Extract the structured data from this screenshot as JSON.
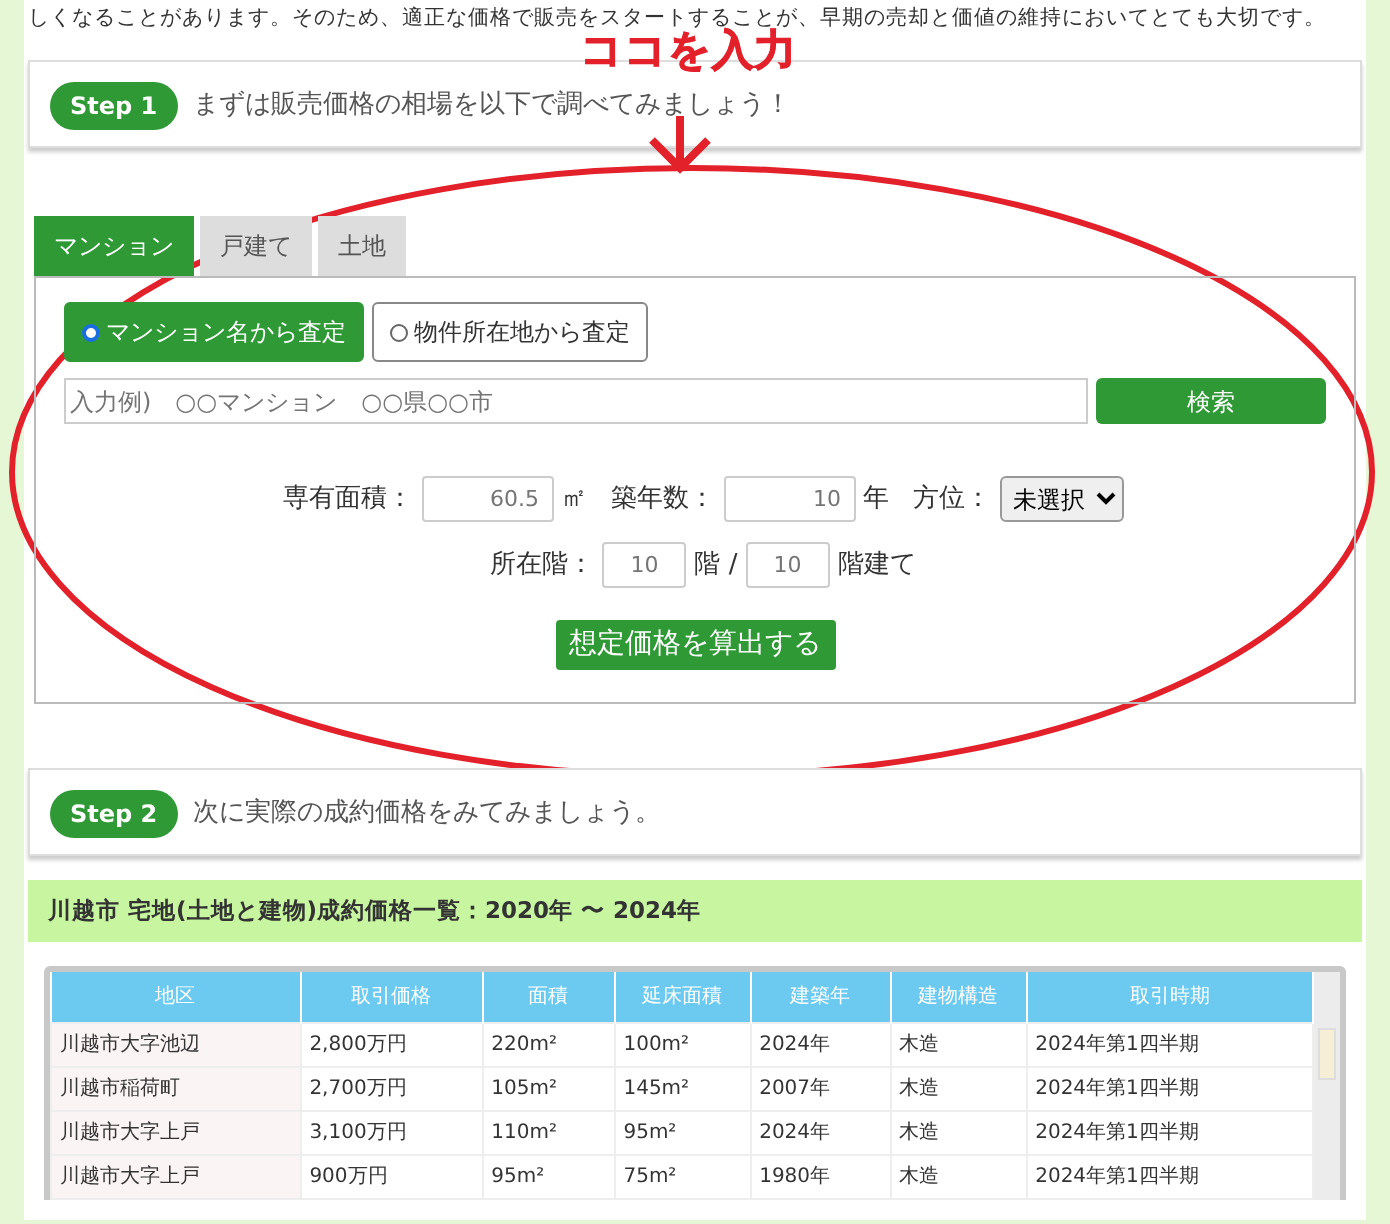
{
  "intro_text": "しくなることがあります。そのため、適正な価格で販売をスタートすることが、早期の売却と価値の維持においてとても大切です。",
  "annotation": {
    "label": "ココを入力"
  },
  "step1": {
    "badge": "Step 1",
    "text": "まずは販売価格の相場を以下で調べてみましょう！"
  },
  "tabs": [
    {
      "label": "マンション",
      "selected": true
    },
    {
      "label": "戸建て",
      "selected": false
    },
    {
      "label": "土地",
      "selected": false
    }
  ],
  "modes": [
    {
      "label": "マンション名から査定",
      "selected": true
    },
    {
      "label": "物件所在地から査定",
      "selected": false
    }
  ],
  "search": {
    "placeholder": "入力例)　○○マンション　○○県○○市",
    "button": "検索"
  },
  "fields_row1": [
    {
      "kind": "input",
      "label": "専有面積：",
      "placeholder": "60.5",
      "unit": "㎡"
    },
    {
      "kind": "input",
      "label": "築年数：",
      "placeholder": "10",
      "unit": "年"
    },
    {
      "kind": "select",
      "label": "方位：",
      "value": "未選択"
    }
  ],
  "fields_row2": [
    {
      "kind": "input",
      "label": "所在階：",
      "placeholder": "10",
      "unit": "階 /"
    },
    {
      "kind": "input",
      "placeholder": "10",
      "unit": "階建て"
    }
  ],
  "calc_button": "想定価格を算出する",
  "step2": {
    "badge": "Step 2",
    "text": "次に実際の成約価格をみてみましょう。"
  },
  "table_heading": "川越市 宅地(土地と建物)成約価格一覧：2020年 〜 2024年",
  "table": {
    "columns": [
      "地区",
      "取引価格",
      "面積",
      "延床面積",
      "建築年",
      "建物構造",
      "取引時期"
    ],
    "rows": [
      [
        "川越市大字池辺",
        "2,800万円",
        "220m²",
        "100m²",
        "2024年",
        "木造",
        "2024年第1四半期"
      ],
      [
        "川越市稲荷町",
        "2,700万円",
        "105m²",
        "145m²",
        "2007年",
        "木造",
        "2024年第1四半期"
      ],
      [
        "川越市大字上戸",
        "3,100万円",
        "110m²",
        "95m²",
        "2024年",
        "木造",
        "2024年第1四半期"
      ],
      [
        "川越市大字上戸",
        "900万円",
        "95m²",
        "75m²",
        "1980年",
        "木造",
        "2024年第1四半期"
      ]
    ]
  }
}
